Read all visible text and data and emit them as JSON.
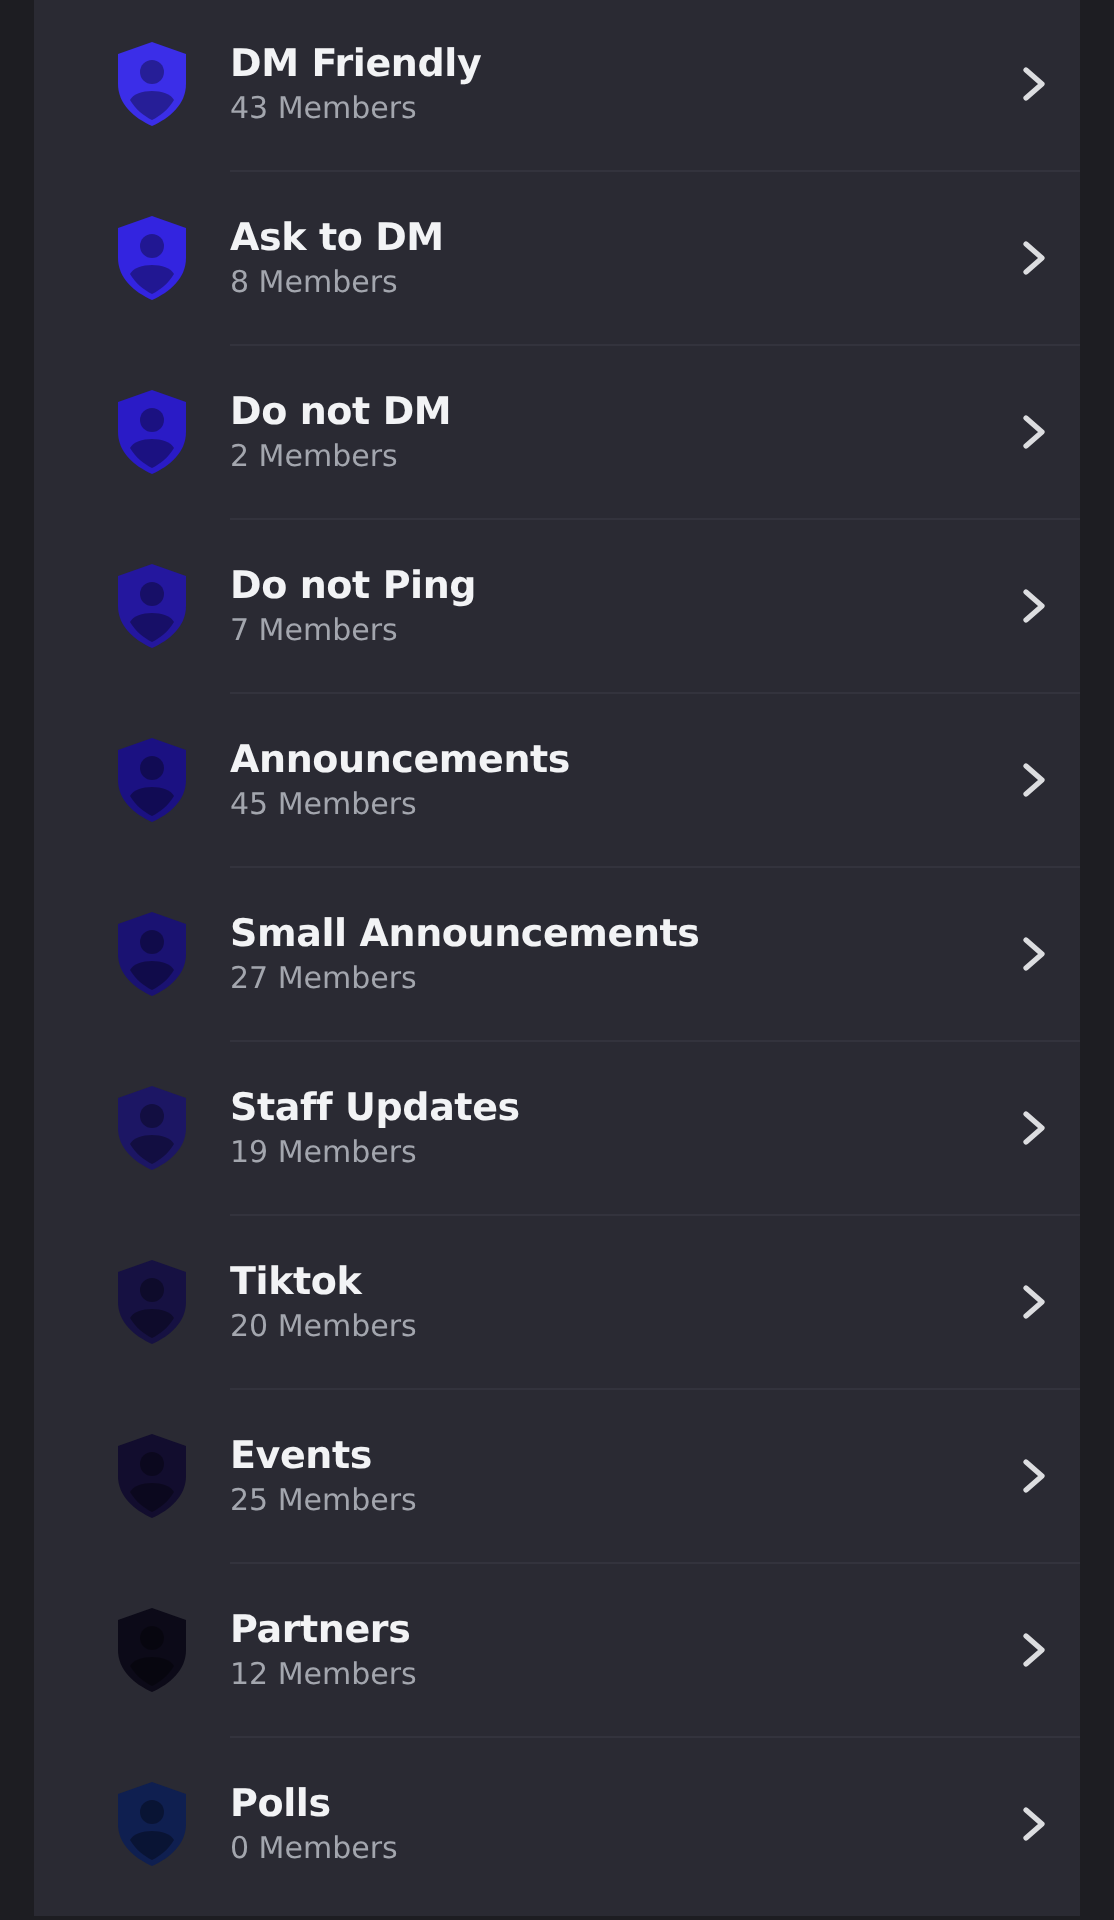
{
  "roles": [
    {
      "name": "DM Friendly",
      "members": "43 Members",
      "color": "#3b2ee8"
    },
    {
      "name": "Ask to DM",
      "members": "8 Members",
      "color": "#3324e0"
    },
    {
      "name": "Do not DM",
      "members": "2 Members",
      "color": "#2a1bc6"
    },
    {
      "name": "Do not Ping",
      "members": "7 Members",
      "color": "#24179e"
    },
    {
      "name": "Announcements",
      "members": "45 Members",
      "color": "#1b1182"
    },
    {
      "name": "Small Announcements",
      "members": "27 Members",
      "color": "#1a1272"
    },
    {
      "name": "Staff Updates",
      "members": "19 Members",
      "color": "#1c1664"
    },
    {
      "name": "Tiktok",
      "members": "20 Members",
      "color": "#161142"
    },
    {
      "name": "Events",
      "members": "25 Members",
      "color": "#120d2e"
    },
    {
      "name": "Partners",
      "members": "12 Members",
      "color": "#0c0a18"
    },
    {
      "name": "Polls",
      "members": "0 Members",
      "color": "#0f1f50"
    }
  ]
}
